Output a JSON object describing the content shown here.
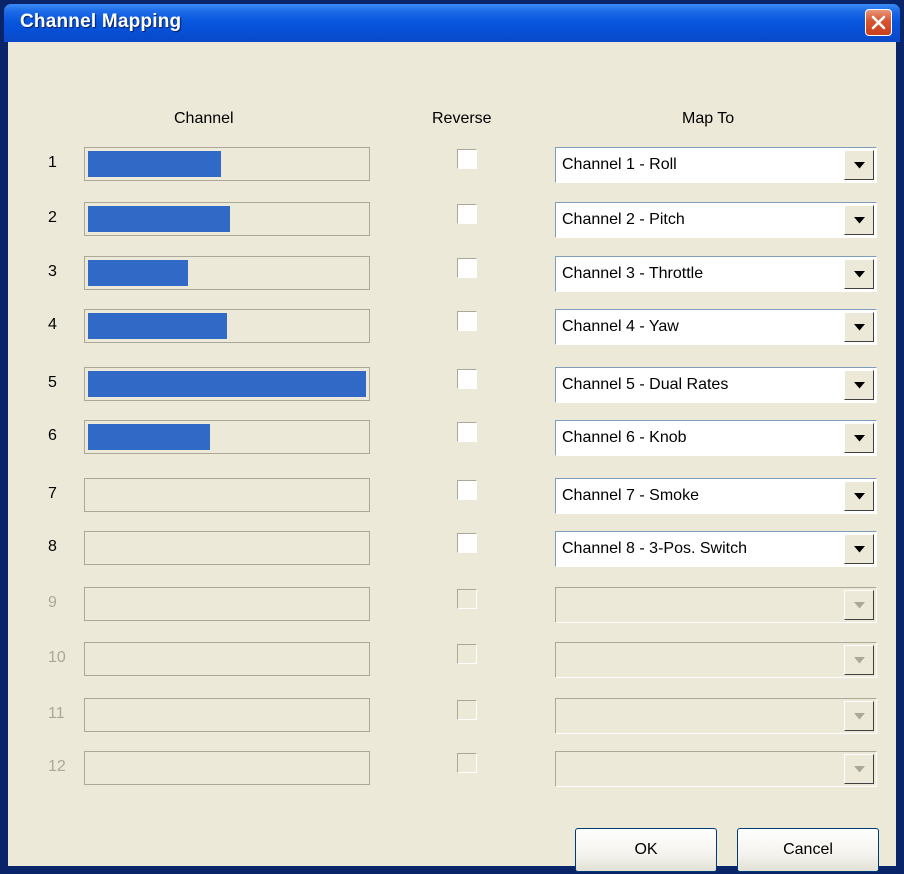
{
  "window": {
    "title": "Channel Mapping",
    "close_icon": "close-x-icon"
  },
  "headers": {
    "channel": "Channel",
    "reverse": "Reverse",
    "map_to": "Map To"
  },
  "rows": [
    {
      "number": "1",
      "level": 0.48,
      "reverse": false,
      "map_to": "Channel 1 - Roll",
      "enabled": true
    },
    {
      "number": "2",
      "level": 0.51,
      "reverse": false,
      "map_to": "Channel 2 - Pitch",
      "enabled": true
    },
    {
      "number": "3",
      "level": 0.36,
      "reverse": false,
      "map_to": "Channel 3 - Throttle",
      "enabled": true
    },
    {
      "number": "4",
      "level": 0.5,
      "reverse": false,
      "map_to": "Channel 4 - Yaw",
      "enabled": true
    },
    {
      "number": "5",
      "level": 1.0,
      "reverse": false,
      "map_to": "Channel 5 - Dual Rates",
      "enabled": true
    },
    {
      "number": "6",
      "level": 0.44,
      "reverse": false,
      "map_to": "Channel 6 - Knob",
      "enabled": true
    },
    {
      "number": "7",
      "level": 0,
      "reverse": false,
      "map_to": "Channel 7 - Smoke",
      "enabled": true
    },
    {
      "number": "8",
      "level": 0,
      "reverse": false,
      "map_to": "Channel 8 - 3-Pos. Switch",
      "enabled": true
    },
    {
      "number": "9",
      "level": 0,
      "reverse": false,
      "map_to": "",
      "enabled": false
    },
    {
      "number": "10",
      "level": 0,
      "reverse": false,
      "map_to": "",
      "enabled": false
    },
    {
      "number": "11",
      "level": 0,
      "reverse": false,
      "map_to": "",
      "enabled": false
    },
    {
      "number": "12",
      "level": 0,
      "reverse": false,
      "map_to": "",
      "enabled": false
    }
  ],
  "buttons": {
    "ok": "OK",
    "cancel": "Cancel"
  },
  "colors": {
    "titlebar": "#0857DD",
    "bar_fill": "#3169C6",
    "dialog_bg": "#ECE9D8",
    "disabled_text": "#ACA899"
  }
}
